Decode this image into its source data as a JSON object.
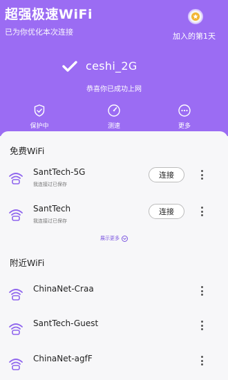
{
  "header": {
    "title": "超强极速WiFi",
    "subtitle": "已为你优化本次连接",
    "medal_icon": "medal-star-icon",
    "joined_text": "加入的第1天",
    "background": "#9b6cf3"
  },
  "connection": {
    "ssid": "ceshi_2G",
    "message": "恭喜你已成功上网"
  },
  "actions": [
    {
      "label": "保护中",
      "icon": "shield-check-icon"
    },
    {
      "label": "测速",
      "icon": "speedometer-icon"
    },
    {
      "label": "更多",
      "icon": "more-icon"
    }
  ],
  "free_wifi": {
    "title": "免费WiFi",
    "items": [
      {
        "name": "SantTech-5G",
        "sub": "我连接过已保存",
        "button": "连接"
      },
      {
        "name": "SantTech",
        "sub": "我连接过已保存",
        "button": "连接"
      }
    ],
    "show_more": "展示更多"
  },
  "nearby_wifi": {
    "title": "附近WiFi",
    "items": [
      {
        "name": "ChinaNet-Craa"
      },
      {
        "name": "SantTech-Guest"
      },
      {
        "name": "ChinaNet-agfF"
      }
    ]
  },
  "colors": {
    "accent": "#9b6cf3",
    "link": "#7b55e0"
  }
}
